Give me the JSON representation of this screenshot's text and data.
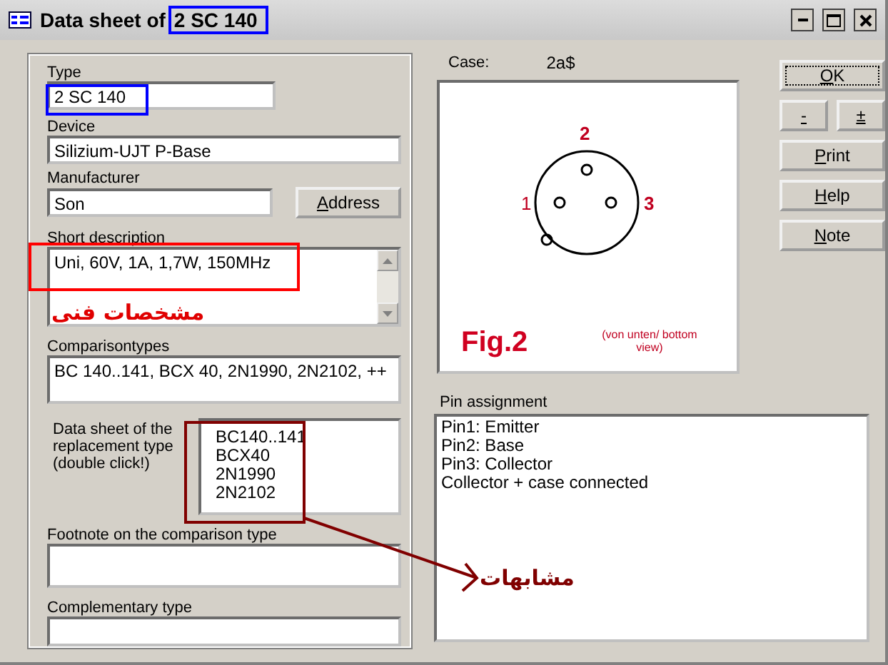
{
  "window": {
    "title": "Data sheet of",
    "title_type": "2 SC 140"
  },
  "fields": {
    "type": {
      "label": "Type",
      "value": "2 SC 140"
    },
    "device": {
      "label": "Device",
      "value": "Silizium-UJT P-Base"
    },
    "manufacturer": {
      "label": "Manufacturer",
      "value": "Son"
    },
    "address_button": "Address",
    "short_description": {
      "label": "Short description",
      "value": "Uni, 60V, 1A, 1,7W, 150MHz"
    },
    "comparison_types": {
      "label": "Comparisontypes",
      "value": "BC 140..141, BCX 40, 2N1990, 2N2102, ++"
    },
    "replacement": {
      "label": "Data sheet of the replacement type (double click!)",
      "items": [
        "BC140..141",
        "BCX40",
        "2N1990",
        "2N2102"
      ]
    },
    "footnote": {
      "label": "Footnote on the comparison type"
    },
    "complementary": {
      "label": "Complementary type"
    }
  },
  "case": {
    "label": "Case:",
    "value": "2a$",
    "pins": [
      "1",
      "2",
      "3"
    ],
    "figure": "Fig.2",
    "view_note": "(von unten/ bottom view)"
  },
  "pin_assignment": {
    "label": "Pin assignment",
    "lines": [
      "Pin1: Emitter",
      "Pin2: Base",
      "Pin3: Collector",
      "Collector + case connected"
    ]
  },
  "buttons": [
    {
      "label": "OK",
      "focused": true
    },
    {
      "label": "-",
      "focused": false
    },
    {
      "label": "±",
      "focused": false
    },
    {
      "label": "Print",
      "focused": false
    },
    {
      "label": "Help",
      "focused": false
    },
    {
      "label": "Note",
      "focused": false
    }
  ],
  "annotations": [
    {
      "kind": "box",
      "color": "#0000ff"
    },
    {
      "kind": "box",
      "color": "#0000ff"
    },
    {
      "kind": "box",
      "color": "#ff0000"
    },
    {
      "kind": "box",
      "color": "#800000"
    },
    {
      "kind": "label",
      "color": "#e00000",
      "text": "مشخصات فنی"
    },
    {
      "kind": "arrow",
      "color": "#800000",
      "text": "مشابهات"
    }
  ]
}
